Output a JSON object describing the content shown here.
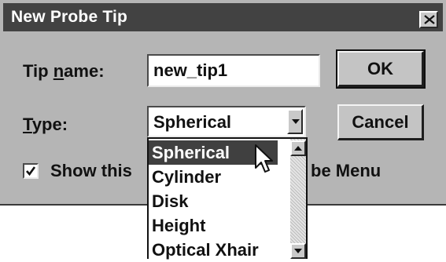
{
  "window": {
    "title": "New Probe Tip",
    "close_icon": "close-icon"
  },
  "form": {
    "tip_name_label_prefix": "Tip ",
    "tip_name_label_mnemonic": "n",
    "tip_name_label_suffix": "ame:",
    "tip_name_value": "new_tip1",
    "type_label_mnemonic": "T",
    "type_label_suffix": "ype:",
    "type_value": "Spherical"
  },
  "buttons": {
    "ok": "OK",
    "cancel": "Cancel"
  },
  "checkbox": {
    "checked": true,
    "label_visible_left": "Show this",
    "label_visible_right": "be Menu"
  },
  "dropdown": {
    "options": [
      "Spherical",
      "Cylinder",
      "Disk",
      "Height",
      "Optical Xhair"
    ],
    "selected_index": 0
  },
  "colors": {
    "titlebar": "#424242",
    "dialog_bg": "#b5b5b5",
    "selection": "#404040"
  }
}
